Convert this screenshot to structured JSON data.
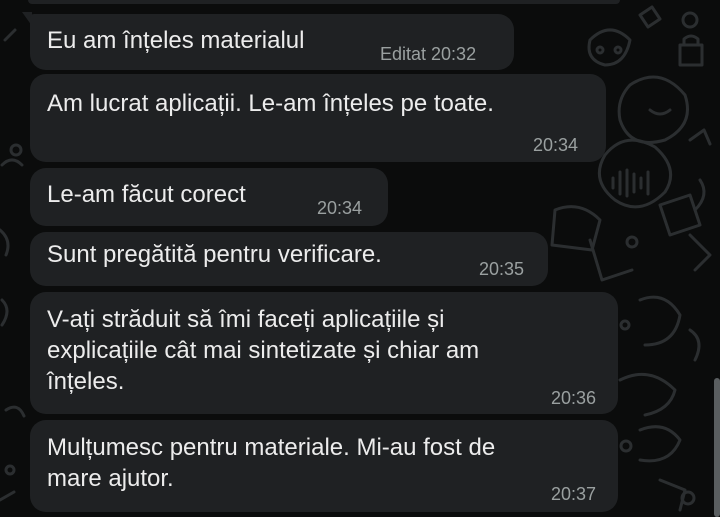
{
  "chat": {
    "messages": [
      {
        "text": "Eu am înțeles materialul",
        "time": "Editat 20:32"
      },
      {
        "text": "Am lucrat aplicații. Le-am înțeles pe toate.",
        "time": "20:34"
      },
      {
        "text": "Le-am făcut corect",
        "time": "20:34"
      },
      {
        "text": "Sunt pregătită pentru verificare.",
        "time": "20:35"
      },
      {
        "text": "V-ați străduit să îmi faceți aplicațiile și\nexplicațiile cât mai sintetizate și chiar am\nînțeles.",
        "time": "20:36"
      },
      {
        "text": "Mulțumesc pentru materiale. Mi-au fost de\nmare ajutor.",
        "time": "20:37"
      }
    ]
  },
  "colors": {
    "background": "#0b0c0c",
    "bubble": "#1f2123",
    "text": "#ececec",
    "timestamp": "#9aa0a0"
  },
  "icons": [
    "chat-wallpaper-doodles-icon"
  ]
}
